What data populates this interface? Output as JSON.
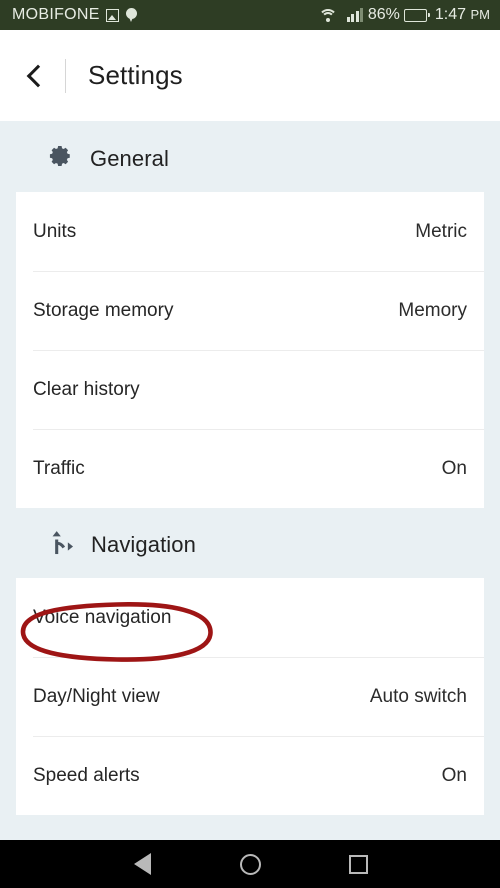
{
  "status_bar": {
    "carrier": "MOBIFONE",
    "icons": [
      "screenshot-icon",
      "location-pin-icon",
      "wifi-icon",
      "signal-icon"
    ],
    "battery_percent": "86%",
    "battery_level": 86,
    "time": "1:47",
    "time_period": "PM",
    "background_color": "#2e3d24"
  },
  "header": {
    "back_label": "back",
    "title": "Settings"
  },
  "sections": [
    {
      "icon": "gear-icon",
      "title": "General",
      "rows": [
        {
          "label": "Units",
          "value": "Metric"
        },
        {
          "label": "Storage memory",
          "value": "Memory"
        },
        {
          "label": "Clear history",
          "value": ""
        },
        {
          "label": "Traffic",
          "value": "On"
        }
      ]
    },
    {
      "icon": "navigation-fork-icon",
      "title": "Navigation",
      "rows": [
        {
          "label": "Voice navigation",
          "value": ""
        },
        {
          "label": "Day/Night view",
          "value": "Auto switch"
        },
        {
          "label": "Speed alerts",
          "value": "On"
        }
      ]
    }
  ],
  "annotation": {
    "target": "Voice navigation",
    "shape": "ellipse",
    "color": "#9e1515"
  },
  "nav_bar": {
    "back": "back-triangle-icon",
    "home": "home-circle-icon",
    "recents": "recents-square-icon"
  }
}
